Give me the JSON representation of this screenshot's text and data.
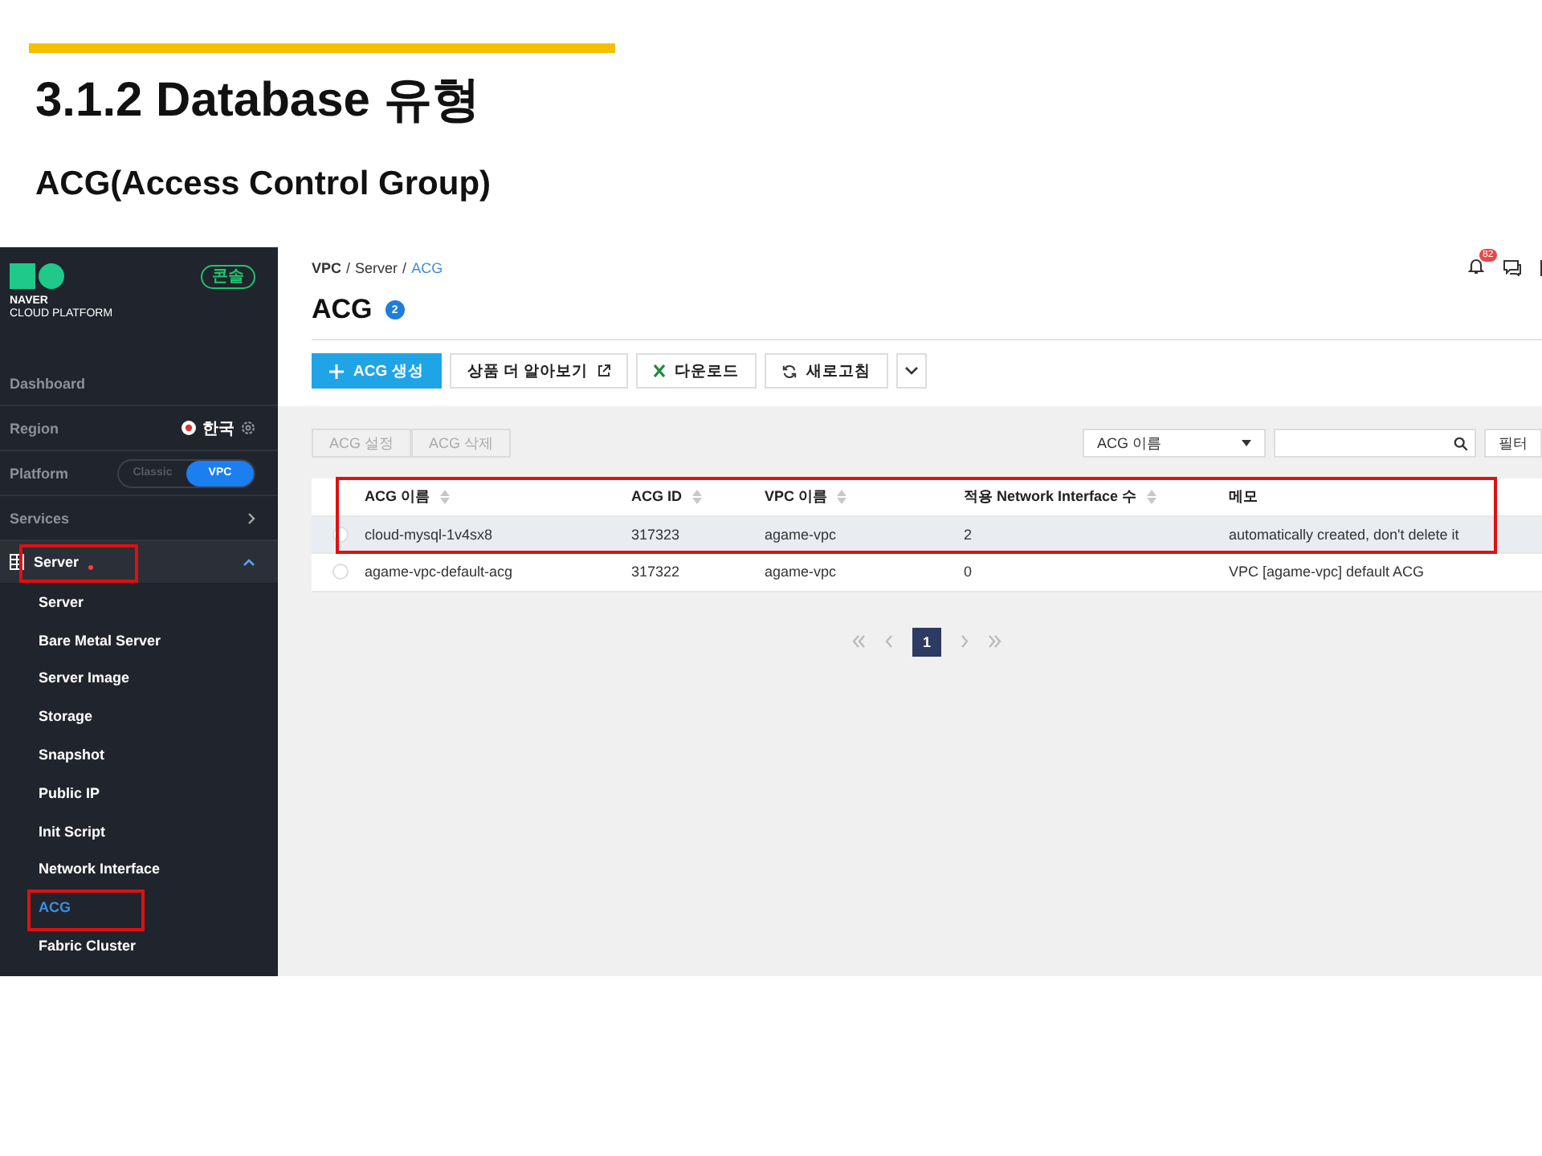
{
  "slide": {
    "title": "3.1.2 Database 유형",
    "subtitle": "ACG(Access Control Group)"
  },
  "sidebar": {
    "brand": "NAVER",
    "brand_sub": "CLOUD PLATFORM",
    "console_badge": "콘솔",
    "items": [
      {
        "kind": "link",
        "label": "Dashboard"
      },
      {
        "kind": "region",
        "label": "Region",
        "value": "한국"
      },
      {
        "kind": "platform",
        "label": "Platform",
        "options": [
          {
            "label": "Classic",
            "selected": false
          },
          {
            "label": "VPC",
            "selected": true
          }
        ]
      },
      {
        "kind": "services",
        "label": "Services"
      },
      {
        "kind": "group",
        "label": "Server",
        "expanded": true,
        "new": true,
        "highlighted": true,
        "children": [
          {
            "label": "Server",
            "selected": false,
            "highlighted": false
          },
          {
            "label": "Bare Metal Server",
            "selected": false,
            "highlighted": false
          },
          {
            "label": "Server Image",
            "selected": false,
            "highlighted": false
          },
          {
            "label": "Storage",
            "selected": false,
            "highlighted": false
          },
          {
            "label": "Snapshot",
            "selected": false,
            "highlighted": false
          },
          {
            "label": "Public IP",
            "selected": false,
            "highlighted": false
          },
          {
            "label": "Init Script",
            "selected": false,
            "highlighted": false
          },
          {
            "label": "Network Interface",
            "selected": false,
            "highlighted": false
          },
          {
            "label": "ACG",
            "selected": true,
            "highlighted": true
          },
          {
            "label": "Fabric Cluster",
            "selected": false,
            "highlighted": false
          }
        ]
      }
    ]
  },
  "main": {
    "breadcrumb": [
      {
        "label": "VPC",
        "current": false
      },
      {
        "label": "Server",
        "current": false
      },
      {
        "label": "ACG",
        "current": true
      }
    ],
    "separator": "/",
    "notification_count": "82",
    "title": "ACG",
    "count": "2",
    "toolbar": [
      {
        "kind": "primary",
        "label": "ACG 생성"
      },
      {
        "kind": "external",
        "label": "상품 더 알아보기"
      },
      {
        "kind": "excel",
        "label": "다운로드"
      },
      {
        "kind": "refresh",
        "label": "새로고침"
      },
      {
        "kind": "more"
      }
    ],
    "actions": [
      {
        "label": "ACG 설정",
        "disabled": true
      },
      {
        "label": "ACG 삭제",
        "disabled": true
      }
    ],
    "search": {
      "field": "ACG 이름"
    },
    "filter_button": "필터",
    "table": {
      "highlighted": true,
      "columns": [
        {
          "label": "ACG 이름",
          "sortable": true
        },
        {
          "label": "ACG ID",
          "sortable": true
        },
        {
          "label": "VPC 이름",
          "sortable": true
        },
        {
          "label": "적용 Network Interface 수",
          "sortable": true
        },
        {
          "label": "메모",
          "sortable": false
        }
      ],
      "rows": [
        {
          "selected": true,
          "cells": [
            "cloud-mysql-1v4sx8",
            "317323",
            "agame-vpc",
            "2",
            "automatically created, don't delete it"
          ]
        },
        {
          "selected": false,
          "cells": [
            "agame-vpc-default-acg",
            "317322",
            "agame-vpc",
            "0",
            "VPC [agame-vpc] default ACG"
          ]
        }
      ]
    },
    "pagination": [
      {
        "label": "1",
        "selected": true
      }
    ]
  }
}
